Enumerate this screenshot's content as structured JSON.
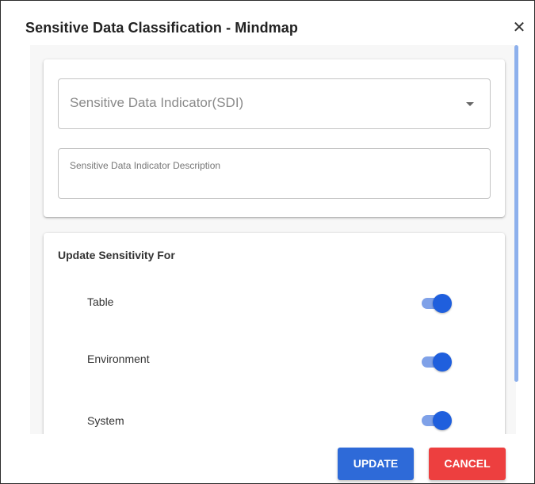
{
  "dialog": {
    "title": "Sensitive Data Classification - Mindmap",
    "close_icon": "close-icon"
  },
  "sdi_field": {
    "placeholder": "Sensitive Data Indicator(SDI)",
    "dropdown_icon": "caret-down-icon"
  },
  "description_field": {
    "placeholder": "Sensitive Data Indicator Description"
  },
  "sensitivity": {
    "title": "Update Sensitivity For",
    "items": [
      {
        "label": "Table",
        "enabled": true
      },
      {
        "label": "Environment",
        "enabled": true
      },
      {
        "label": "System",
        "enabled": true
      }
    ]
  },
  "buttons": {
    "update": "UPDATE",
    "cancel": "CANCEL"
  },
  "colors": {
    "update_button": "#2e6ad8",
    "cancel_button": "#ed3f3f",
    "toggle_track": "#7fa1e8",
    "toggle_thumb": "#1f5fdd",
    "scrollbar": "#8db0ec"
  }
}
